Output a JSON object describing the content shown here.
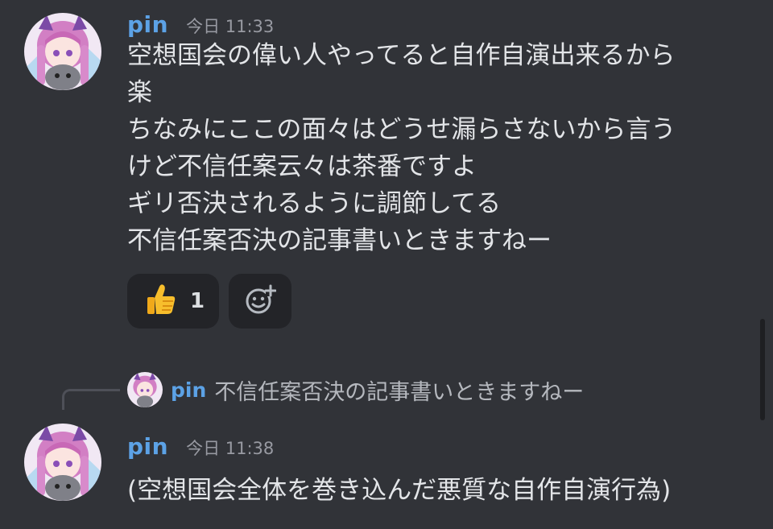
{
  "messages": [
    {
      "author": "pin",
      "timestamp": "今日 11:33",
      "lines": [
        "空想国会の偉い人やってると自作自演出来るから",
        "楽",
        "ちなみにここの面々はどうせ漏らさないから言う",
        "けど不信任案云々は茶番ですよ",
        "ギリ否決されるように調節してる",
        "不信任案否決の記事書いときますねー"
      ],
      "reactions": [
        {
          "emoji": "thumbs-up-icon",
          "count": "1"
        }
      ]
    },
    {
      "author": "pin",
      "timestamp": "今日 11:38",
      "reply": {
        "author": "pin",
        "text": "不信任案否決の記事書いときますねー"
      },
      "lines": [
        "(空想国会全体を巻き込んだ悪質な自作自演行為)"
      ]
    }
  ],
  "colors": {
    "background": "#313338",
    "author": "#5ca2e6",
    "timestamp": "#989aa2",
    "reaction_bg": "#232428"
  }
}
